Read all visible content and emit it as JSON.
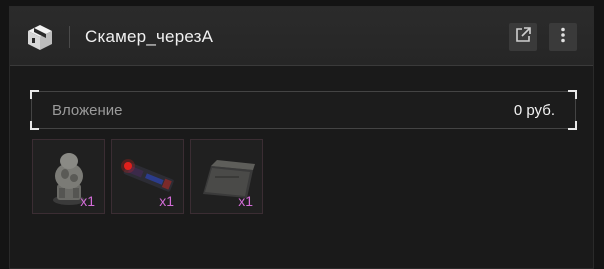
{
  "header": {
    "title": "Скамер_черезА",
    "icons": [
      "box-logo-icon",
      "external-link-icon",
      "more-vertical-icon"
    ]
  },
  "investment": {
    "label": "Вложение",
    "value": "0 руб."
  },
  "items": [
    {
      "name": "statue",
      "quantity": "x1"
    },
    {
      "name": "laser-device",
      "quantity": "x1"
    },
    {
      "name": "metal-plate",
      "quantity": "x1"
    }
  ],
  "colors": {
    "background": "#141414",
    "header": "#2b2b2b",
    "quantity": "#d36cd8",
    "slot_border": "#3b2d33"
  }
}
